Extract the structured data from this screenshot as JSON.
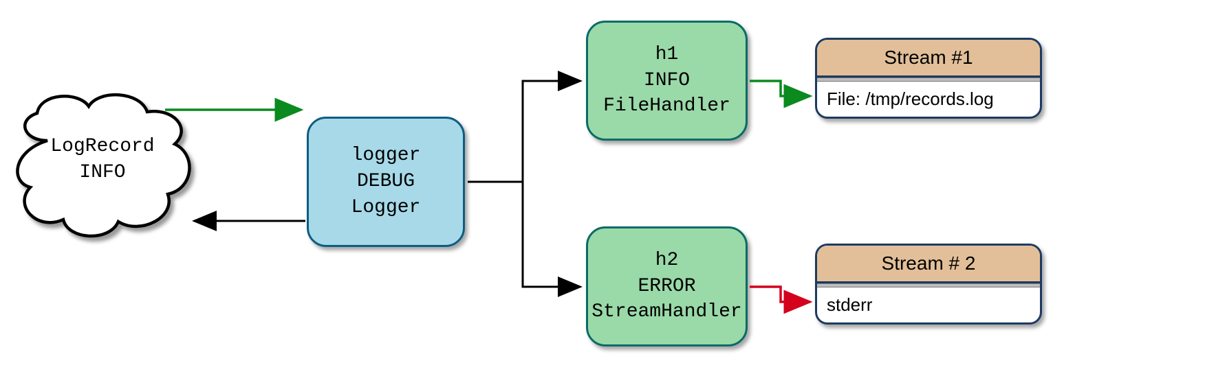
{
  "record": {
    "name": "LogRecord",
    "level": "INFO"
  },
  "logger": {
    "name": "logger",
    "level": "DEBUG",
    "class": "Logger"
  },
  "handlers": {
    "h1": {
      "name": "h1",
      "level": "INFO",
      "class": "FileHandler"
    },
    "h2": {
      "name": "h2",
      "level": "ERROR",
      "class": "StreamHandler"
    }
  },
  "streams": {
    "s1": {
      "title": "Stream #1",
      "body": "File: /tmp/records.log"
    },
    "s2": {
      "title": "Stream # 2",
      "body": "stderr"
    }
  },
  "arrows": {
    "record_to_logger": {
      "color": "#0a8a1f",
      "pass": true
    },
    "logger_to_record": {
      "color": "#000000"
    },
    "logger_to_h1": {
      "color": "#000000"
    },
    "logger_to_h2": {
      "color": "#000000"
    },
    "h1_to_s1": {
      "color": "#0a8a1f",
      "pass": true
    },
    "h2_to_s2": {
      "color": "#d4021d",
      "pass": false
    }
  }
}
